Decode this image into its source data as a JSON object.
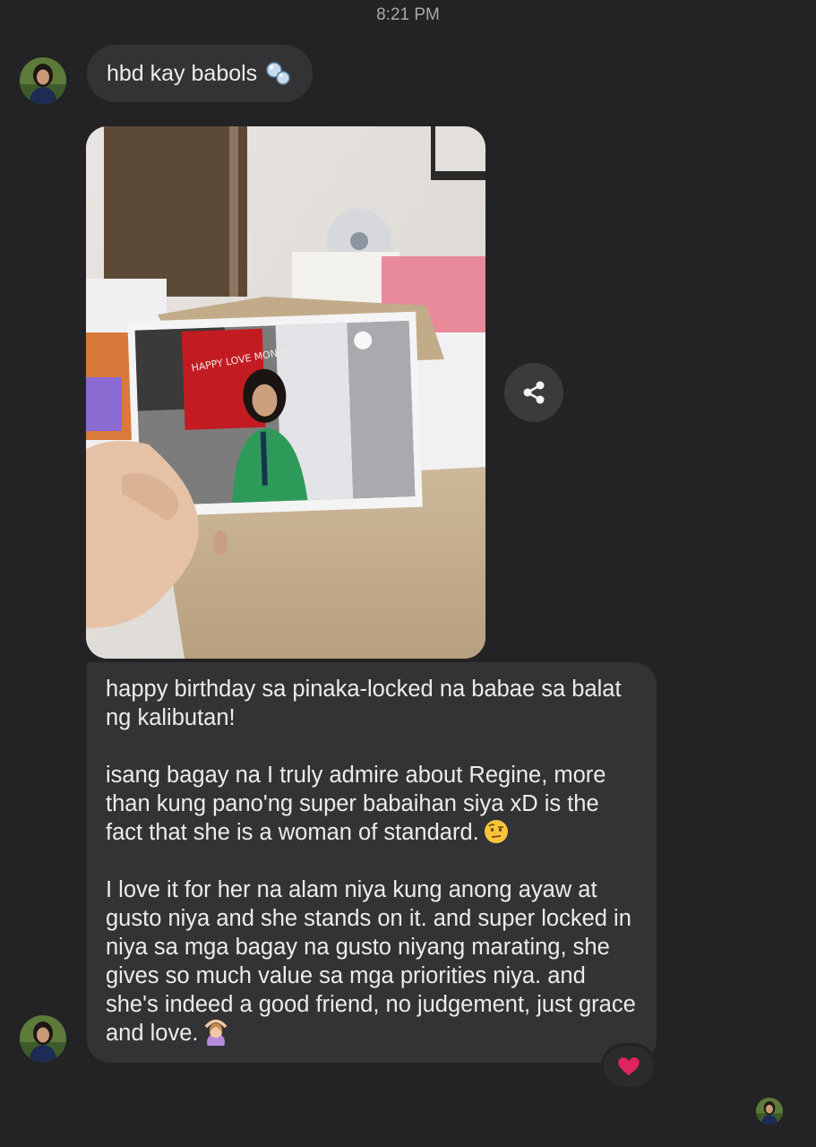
{
  "header": {
    "timestamp": "8:21 PM"
  },
  "messages": {
    "first": {
      "text": "hbd kay babols",
      "emoji": "bubbles-emoji"
    },
    "photo": {
      "sign_text": "HAPPY LOVE MONTH",
      "description_icon": "photo-attachment"
    },
    "share": {
      "icon": "share-icon"
    },
    "long": {
      "paragraphs": [
        "happy birthday sa pinaka-locked na babae sa balat ng kalibutan!",
        "isang bagay na I truly admire about Regine, more than kung pano'ng super babaihan siya xD is the fact that she is a woman of standard.",
        "I love it for her na alam niya kung anong ayaw at gusto niya and she stands on it. and super locked in niya sa mga bagay na gusto niyang marating, she gives so much value sa mga priorities niya. and she's indeed a good friend, no judgement, just grace and love."
      ],
      "emoji_1": "face-with-raised-eyebrow-emoji",
      "emoji_2": "person-gesturing-ok-emoji"
    },
    "reaction": {
      "emoji": "red-heart-emoji"
    }
  },
  "colors": {
    "background": "#232325",
    "bubble": "#333335",
    "text": "#ececec",
    "timestamp": "#a9a9ad",
    "heart": "#e0245e"
  }
}
